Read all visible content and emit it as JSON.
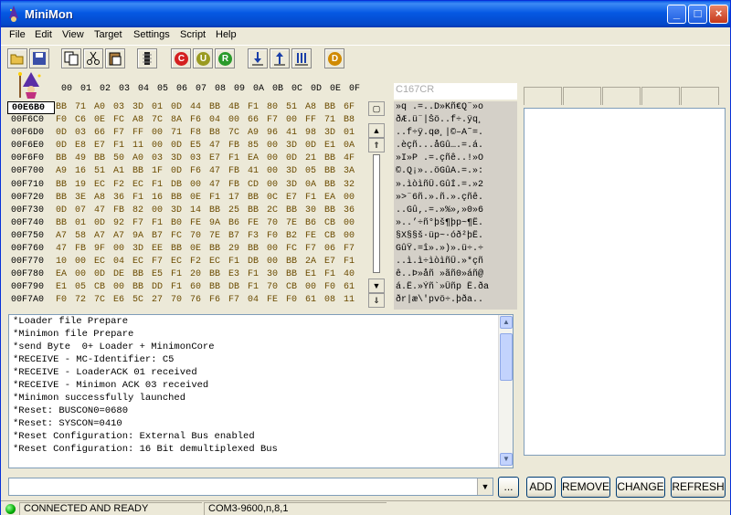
{
  "window": {
    "title": "MiniMon"
  },
  "menu": [
    "File",
    "Edit",
    "View",
    "Target",
    "Settings",
    "Script",
    "Help"
  ],
  "toolbar": {
    "round_buttons": [
      {
        "letter": "C",
        "color": "#d42020"
      },
      {
        "letter": "U",
        "color": "#9a9a20"
      },
      {
        "letter": "R",
        "color": "#2a9a2a"
      },
      {
        "letter": "D",
        "color": "#d08a00"
      }
    ]
  },
  "memory": {
    "chip": "C167CR",
    "columns": [
      "00",
      "01",
      "02",
      "03",
      "04",
      "05",
      "06",
      "07",
      "08",
      "09",
      "0A",
      "0B",
      "0C",
      "0D",
      "0E",
      "0F"
    ],
    "rows": [
      {
        "addr": "00E6B0",
        "bytes": [
          "BB",
          "71",
          "A0",
          "03",
          "3D",
          "01",
          "0D",
          "44",
          "BB",
          "4B",
          "F1",
          "80",
          "51",
          "A8",
          "BB",
          "6F"
        ],
        "ascii": "»q .=..D»Kñ€Q¨»o"
      },
      {
        "addr": "00F6C0",
        "bytes": [
          "F0",
          "C6",
          "0E",
          "FC",
          "A8",
          "7C",
          "8A",
          "F6",
          "04",
          "00",
          "66",
          "F7",
          "00",
          "FF",
          "71",
          "B8"
        ],
        "ascii": "ðÆ.ü¨|Šö..f÷.ÿq¸"
      },
      {
        "addr": "00F6D0",
        "bytes": [
          "0D",
          "03",
          "66",
          "F7",
          "FF",
          "00",
          "71",
          "F8",
          "B8",
          "7C",
          "A9",
          "96",
          "41",
          "98",
          "3D",
          "01"
        ],
        "ascii": "..f÷ÿ.qø¸|©–A˜=."
      },
      {
        "addr": "00F6E0",
        "bytes": [
          "0D",
          "E8",
          "E7",
          "F1",
          "11",
          "00",
          "0D",
          "E5",
          "47",
          "FB",
          "85",
          "00",
          "3D",
          "0D",
          "E1",
          "0A"
        ],
        "ascii": ".èçñ...åGû….=.á."
      },
      {
        "addr": "00F6F0",
        "bytes": [
          "BB",
          "49",
          "BB",
          "50",
          "A0",
          "03",
          "3D",
          "03",
          "E7",
          "F1",
          "EA",
          "00",
          "0D",
          "21",
          "BB",
          "4F"
        ],
        "ascii": "»I»P .=.çñê..!»O"
      },
      {
        "addr": "00F700",
        "bytes": [
          "A9",
          "16",
          "51",
          "A1",
          "BB",
          "1F",
          "0D",
          "F6",
          "47",
          "FB",
          "41",
          "00",
          "3D",
          "05",
          "BB",
          "3A"
        ],
        "ascii": "©.Q¡»..öGûA.=.»:"
      },
      {
        "addr": "00F710",
        "bytes": [
          "BB",
          "19",
          "EC",
          "F2",
          "EC",
          "F1",
          "DB",
          "00",
          "47",
          "FB",
          "CD",
          "00",
          "3D",
          "0A",
          "BB",
          "32"
        ],
        "ascii": "».ìòìñÛ.GûÍ.=.»2"
      },
      {
        "addr": "00F720",
        "bytes": [
          "BB",
          "3E",
          "A8",
          "36",
          "F1",
          "16",
          "BB",
          "0E",
          "F1",
          "17",
          "BB",
          "0C",
          "E7",
          "F1",
          "EA",
          "00"
        ],
        "ascii": "»>¨6ñ.».ñ.».çñê."
      },
      {
        "addr": "00F730",
        "bytes": [
          "0D",
          "07",
          "47",
          "FB",
          "82",
          "00",
          "3D",
          "14",
          "BB",
          "25",
          "BB",
          "2C",
          "BB",
          "30",
          "BB",
          "36"
        ],
        "ascii": "..Gû‚.=.»%»,»0»6"
      },
      {
        "addr": "00F740",
        "bytes": [
          "BB",
          "01",
          "0D",
          "92",
          "F7",
          "F1",
          "B0",
          "FE",
          "9A",
          "B6",
          "FE",
          "70",
          "7E",
          "B6",
          "CB",
          "00"
        ],
        "ascii": "»..’÷ñ°þš¶þp~¶Ë."
      },
      {
        "addr": "00F750",
        "bytes": [
          "A7",
          "58",
          "A7",
          "A7",
          "9A",
          "B7",
          "FC",
          "70",
          "7E",
          "B7",
          "F3",
          "F0",
          "B2",
          "FE",
          "CB",
          "00"
        ],
        "ascii": "§X§§š·üp~·óð²þË."
      },
      {
        "addr": "00F760",
        "bytes": [
          "47",
          "FB",
          "9F",
          "00",
          "3D",
          "EE",
          "BB",
          "0E",
          "BB",
          "29",
          "BB",
          "00",
          "FC",
          "F7",
          "06",
          "F7"
        ],
        "ascii": "GûŸ.=î».»)».ü÷.÷"
      },
      {
        "addr": "00F770",
        "bytes": [
          "10",
          "00",
          "EC",
          "04",
          "EC",
          "F7",
          "EC",
          "F2",
          "EC",
          "F1",
          "DB",
          "00",
          "BB",
          "2A",
          "E7",
          "F1"
        ],
        "ascii": "..ì.ì÷ìòìñÛ.»*çñ"
      },
      {
        "addr": "00F780",
        "bytes": [
          "EA",
          "00",
          "0D",
          "DE",
          "BB",
          "E5",
          "F1",
          "20",
          "BB",
          "E3",
          "F1",
          "30",
          "BB",
          "E1",
          "F1",
          "40"
        ],
        "ascii": "ê..Þ»åñ »ãñ0»áñ@"
      },
      {
        "addr": "00F790",
        "bytes": [
          "E1",
          "05",
          "CB",
          "00",
          "BB",
          "DD",
          "F1",
          "60",
          "BB",
          "DB",
          "F1",
          "70",
          "CB",
          "00",
          "F0",
          "61"
        ],
        "ascii": "á.Ë.»Ýñ`»Ûñp Ë.ða"
      },
      {
        "addr": "00F7A0",
        "bytes": [
          "F0",
          "72",
          "7C",
          "E6",
          "5C",
          "27",
          "70",
          "76",
          "F6",
          "F7",
          "04",
          "FE",
          "F0",
          "61",
          "08",
          "11"
        ],
        "ascii": "ðr|æ\\'pvö÷.þða.."
      }
    ]
  },
  "log": [
    "*Loader file Prepare",
    "*Minimon file Prepare",
    "*send Byte  0+ Loader + MinimonCore",
    "*RECEIVE - MC-Identifier: C5",
    "*RECEIVE - LoaderACK 01 received",
    "*RECEIVE - Minimon ACK 03 received",
    "*Minimon successfully launched",
    "*Reset: BUSCON0=0680",
    "*Reset: SYSCON=0410",
    "*Reset Configuration: External Bus enabled",
    "*Reset Configuration: 16 Bit demultiplexed Bus"
  ],
  "command": {
    "value": "",
    "browse_label": "..."
  },
  "buttons": {
    "add": "ADD",
    "remove": "REMOVE",
    "change": "CHANGE",
    "refresh": "REFRESH"
  },
  "status": {
    "connection": "CONNECTED AND READY",
    "port": "COM3-9600,n,8,1",
    "led_color": "#00aa00"
  }
}
